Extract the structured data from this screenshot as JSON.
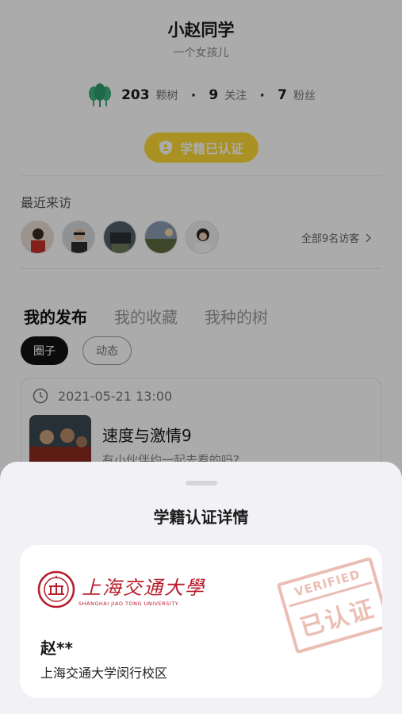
{
  "profile": {
    "name": "小赵同学",
    "bio": "一个女孩儿",
    "tree_count": "203",
    "tree_label": "颗树",
    "following_count": "9",
    "following_label": "关注",
    "followers_count": "7",
    "followers_label": "粉丝",
    "verified_label": "学籍已认证",
    "accent_color": "#fdd835",
    "tree_icon_color": "#3fb27f"
  },
  "recent_visitors": {
    "title": "最近来访",
    "all_label": "全部9名访客",
    "avatars": [
      "visitor-1",
      "visitor-2",
      "visitor-3",
      "visitor-4",
      "visitor-5"
    ]
  },
  "tabs": [
    {
      "label": "我的发布",
      "active": true
    },
    {
      "label": "我的收藏",
      "active": false
    },
    {
      "label": "我种的树",
      "active": false
    }
  ],
  "filters": [
    {
      "label": "圈子",
      "active": true
    },
    {
      "label": "动态",
      "active": false
    }
  ],
  "post": {
    "timestamp": "2021-05-21 13:00",
    "title": "速度与激情9",
    "excerpt": "有小伙伴约一起去看的吗?"
  },
  "sheet": {
    "title": "学籍认证详情",
    "university_cn": "上海交通大學",
    "university_en": "SHANGHAI JIAO TONG UNIVERSITY",
    "student_name": "赵**",
    "campus": "上海交通大学闵行校区",
    "stamp_en": "VERIFIED",
    "stamp_cn": "已认证",
    "brand_color": "#b71c2b"
  }
}
